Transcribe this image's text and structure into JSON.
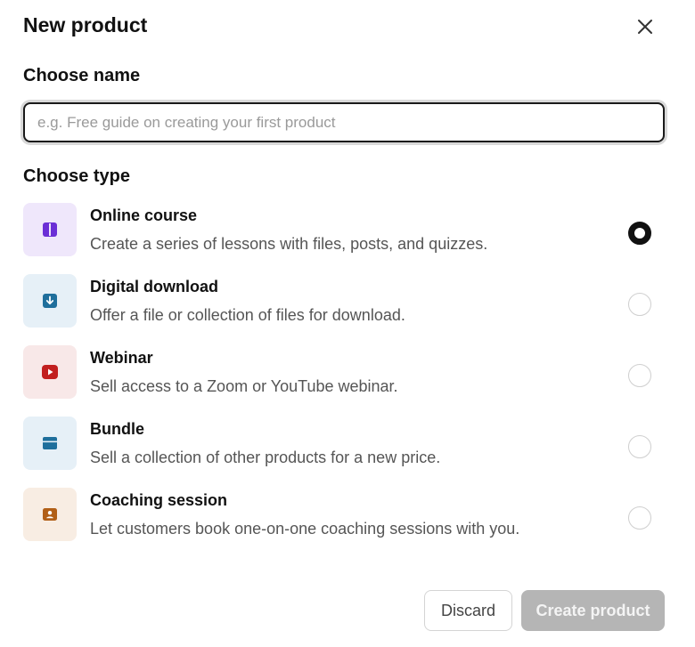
{
  "modal": {
    "title": "New product",
    "close_icon": "close-icon"
  },
  "name_section": {
    "label": "Choose name",
    "placeholder": "e.g. Free guide on creating your first product",
    "value": ""
  },
  "type_section": {
    "label": "Choose type",
    "selected": "online-course",
    "options": [
      {
        "id": "online-course",
        "name": "Online course",
        "description": "Create a series of lessons with files, posts, and quizzes.",
        "icon": "book-icon",
        "icon_bg": "#efe7fb",
        "icon_color": "#6b2fd6",
        "selected": true
      },
      {
        "id": "digital-download",
        "name": "Digital download",
        "description": "Offer a file or collection of files for download.",
        "icon": "download-icon",
        "icon_bg": "#e6f0f7",
        "icon_color": "#1f6f9c",
        "selected": false
      },
      {
        "id": "webinar",
        "name": "Webinar",
        "description": "Sell access to a Zoom or YouTube webinar.",
        "icon": "play-icon",
        "icon_bg": "#f8e8e8",
        "icon_color": "#c21f1f",
        "selected": false
      },
      {
        "id": "bundle",
        "name": "Bundle",
        "description": "Sell a collection of other products for a new price.",
        "icon": "stack-icon",
        "icon_bg": "#e6f0f7",
        "icon_color": "#1f6f9c",
        "selected": false
      },
      {
        "id": "coaching-session",
        "name": "Coaching session",
        "description": "Let customers book one-on-one coaching sessions with you.",
        "icon": "person-badge-icon",
        "icon_bg": "#f8ede3",
        "icon_color": "#b15f17",
        "selected": false
      }
    ]
  },
  "footer": {
    "discard_label": "Discard",
    "create_label": "Create product"
  }
}
